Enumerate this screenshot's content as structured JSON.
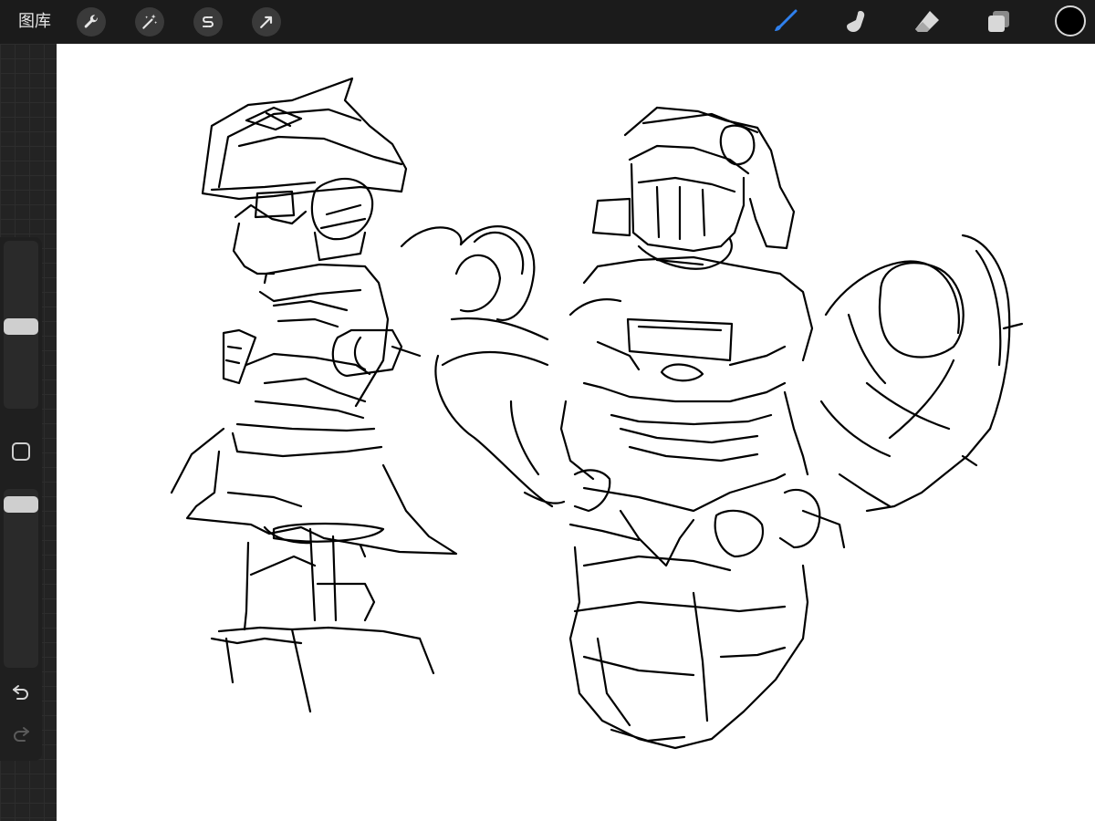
{
  "toolbar": {
    "gallery_label": "图库",
    "left_tools": [
      {
        "name": "actions",
        "icon": "wrench-icon"
      },
      {
        "name": "adjustments",
        "icon": "magic-wand-icon"
      },
      {
        "name": "selection",
        "icon": "selection-s-icon"
      },
      {
        "name": "transform",
        "icon": "arrow-cursor-icon"
      }
    ],
    "right_tools": [
      {
        "name": "brush",
        "icon": "brush-icon",
        "active": true
      },
      {
        "name": "smudge",
        "icon": "smudge-finger-icon",
        "active": false
      },
      {
        "name": "eraser",
        "icon": "eraser-icon",
        "active": false
      },
      {
        "name": "layers",
        "icon": "layers-icon",
        "active": false
      }
    ],
    "current_color": "#000000"
  },
  "sidebar": {
    "brush_size_slider": {
      "level": 0.6
    },
    "opacity_slider": {
      "level": 0.95
    },
    "modify_button_icon": "square-icon",
    "undo_icon": "undo-icon",
    "redo_icon": "redo-icon"
  },
  "colors": {
    "accent": "#2f80ed",
    "toolbar_bg": "#1b1b1b",
    "canvas_bg": "#ffffff",
    "stroke": "#000000"
  }
}
